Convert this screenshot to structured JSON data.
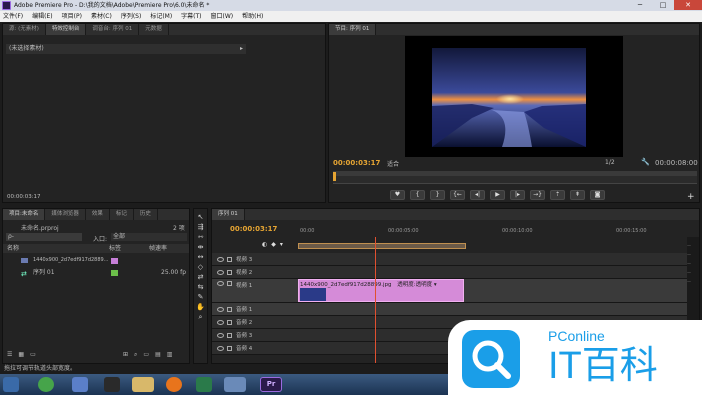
{
  "window": {
    "title": "Adobe Premiere Pro - D:\\我的文档\\Adobe\\Premiere Pro\\6.0\\未命名 *",
    "min": "─",
    "max": "□",
    "close": "✕"
  },
  "menu": [
    "文件(F)",
    "编辑(E)",
    "项目(P)",
    "素材(C)",
    "序列(S)",
    "标记(M)",
    "字幕(T)",
    "窗口(W)",
    "帮助(H)"
  ],
  "source_panel": {
    "tabs": [
      "源: (无素材)",
      "特效控制台",
      "调音台: 序列 01",
      "元数据"
    ],
    "clip_label": "(未选择素材)",
    "timecode": "00:00:03:17"
  },
  "program": {
    "tab": "节目: 序列 01",
    "timecode": "00:00:03:17",
    "fit": "适合",
    "zoom": "1/2",
    "duration": "00:00:08:00"
  },
  "project": {
    "tabs": [
      "项目:未命名",
      "媒体浏览器",
      "效果",
      "标记",
      "历史"
    ],
    "name": "未命名.prproj",
    "count": "2 项",
    "search_icon": "ρ-",
    "in_label": "入口:",
    "in_value": "全部",
    "columns": [
      "名称",
      "标签",
      "帧速率"
    ],
    "items": [
      {
        "name": "1440x900_2d7edf917d2889...",
        "label_color": "#c77fd8",
        "rate": ""
      },
      {
        "name": "序列 01",
        "label_color": "#6cbf4a",
        "rate": "25.00 fp"
      }
    ]
  },
  "timeline": {
    "tab": "序列 01",
    "timecode": "00:00:03:17",
    "ruler": [
      "00:00",
      "00:00:05:00",
      "00:00:10:00",
      "00:00:15:00"
    ],
    "tracks": [
      {
        "name": "视频 3"
      },
      {
        "name": "视频 2"
      },
      {
        "name": "视频 1"
      },
      {
        "name": "音频 1"
      },
      {
        "name": "音频 2"
      },
      {
        "name": "音频 3"
      },
      {
        "name": "音频 4"
      }
    ],
    "clip": {
      "name": "1440x900_2d7edf917d28899.jpg",
      "fx": "透明度:透明度 ▾"
    }
  },
  "status": "拖拉可调节轨道头部宽度。",
  "watermark": {
    "brand": "PConline",
    "name": "IT百科"
  },
  "colors": {
    "accent": "#e6a533",
    "clip": "#d58bd8",
    "playhead": "#e05030"
  }
}
